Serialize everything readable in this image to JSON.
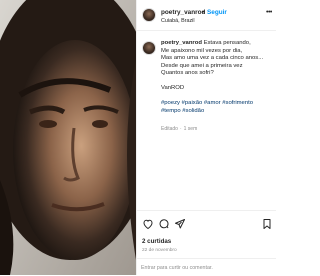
{
  "post": {
    "image_alt_icon": "portrait-painting"
  },
  "header": {
    "username": "poetry_vanrod",
    "separator": "•",
    "follow_label": "Seguir",
    "location": "Cuiabá, Brazil",
    "more_icon": "more-horizontal-icon"
  },
  "caption": {
    "username": "poetry_vanrod",
    "lines": [
      "Estava pensando,",
      "Me apaixono mil vezes por dia,",
      "Mas amo uma vez a cada cinco anos...",
      "Desde que amei a primeira vez",
      "Quantos anos sofri?",
      "",
      "VanROD",
      "",
      "#poezy #paixão #amor #sofrimento",
      "#tempo #solidão"
    ],
    "edited": "Editado",
    "dot": "·",
    "age": "1 sem"
  },
  "actions": {
    "like_icon": "heart-icon",
    "comment_icon": "comment-icon",
    "share_icon": "share-icon",
    "save_icon": "bookmark-icon"
  },
  "likes": "2 curtidas",
  "date": "22 de novembro",
  "comment": {
    "placeholder": "Entrar para curtir ou comentar."
  },
  "colors": {
    "link": "#0095f6",
    "hashtag": "#00376b",
    "muted": "#8e8e8e"
  }
}
